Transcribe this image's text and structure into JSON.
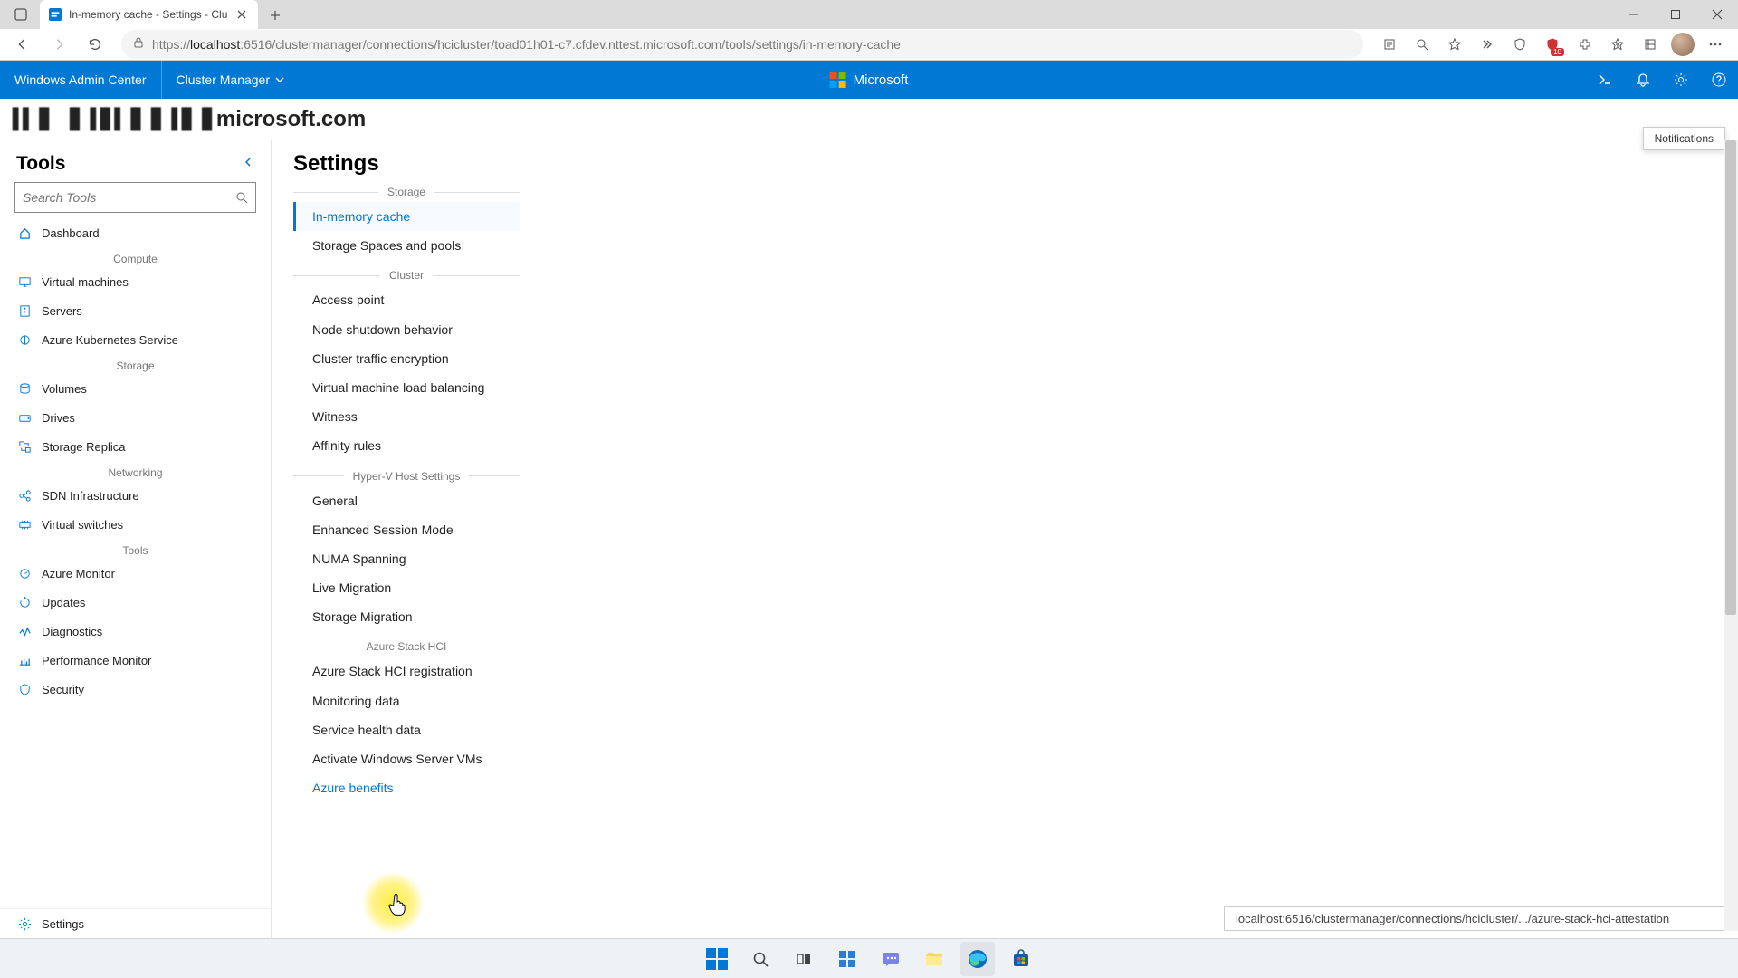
{
  "browser": {
    "tab_title": "In-memory cache - Settings - Clu",
    "url_prefix": "https://",
    "url_host": "localhost",
    "url_port_path": ":6516/clustermanager/connections/hcicluster/toad01h01-c7.cfdev.nttest.microsoft.com/tools/settings/in-memory-cache",
    "shield_badge": "10"
  },
  "wac": {
    "brand": "Windows Admin Center",
    "context": "Cluster Manager",
    "ms_label": "Microsoft"
  },
  "host_domain": "microsoft.com",
  "notifications_tooltip": "Notifications",
  "tools": {
    "title": "Tools",
    "search_placeholder": "Search Tools",
    "groups": [
      {
        "label": "",
        "items": [
          {
            "icon": "home",
            "label": "Dashboard"
          }
        ]
      },
      {
        "label": "Compute",
        "items": [
          {
            "icon": "vm",
            "label": "Virtual machines"
          },
          {
            "icon": "server",
            "label": "Servers"
          },
          {
            "icon": "aks",
            "label": "Azure Kubernetes Service"
          }
        ]
      },
      {
        "label": "Storage",
        "items": [
          {
            "icon": "volume",
            "label": "Volumes"
          },
          {
            "icon": "drive",
            "label": "Drives"
          },
          {
            "icon": "replica",
            "label": "Storage Replica"
          }
        ]
      },
      {
        "label": "Networking",
        "items": [
          {
            "icon": "sdn",
            "label": "SDN Infrastructure"
          },
          {
            "icon": "vswitch",
            "label": "Virtual switches"
          }
        ]
      },
      {
        "label": "Tools",
        "items": [
          {
            "icon": "monitor",
            "label": "Azure Monitor"
          },
          {
            "icon": "updates",
            "label": "Updates"
          },
          {
            "icon": "diag",
            "label": "Diagnostics"
          },
          {
            "icon": "perf",
            "label": "Performance Monitor"
          },
          {
            "icon": "security",
            "label": "Security"
          }
        ]
      }
    ],
    "settings_label": "Settings"
  },
  "settings": {
    "title": "Settings",
    "groups": [
      {
        "label": "Storage",
        "items": [
          {
            "label": "In-memory cache",
            "active": true
          },
          {
            "label": "Storage Spaces and pools"
          }
        ]
      },
      {
        "label": "Cluster",
        "items": [
          {
            "label": "Access point"
          },
          {
            "label": "Node shutdown behavior"
          },
          {
            "label": "Cluster traffic encryption"
          },
          {
            "label": "Virtual machine load balancing"
          },
          {
            "label": "Witness"
          },
          {
            "label": "Affinity rules"
          }
        ]
      },
      {
        "label": "Hyper-V Host Settings",
        "items": [
          {
            "label": "General"
          },
          {
            "label": "Enhanced Session Mode"
          },
          {
            "label": "NUMA Spanning"
          },
          {
            "label": "Live Migration"
          },
          {
            "label": "Storage Migration"
          }
        ]
      },
      {
        "label": "Azure Stack HCI",
        "items": [
          {
            "label": "Azure Stack HCI registration"
          },
          {
            "label": "Monitoring data"
          },
          {
            "label": "Service health data"
          },
          {
            "label": "Activate Windows Server VMs"
          },
          {
            "label": "Azure benefits",
            "hover": true
          }
        ]
      }
    ]
  },
  "link_preview": "localhost:6516/clustermanager/connections/hcicluster/.../azure-stack-hci-attestation"
}
